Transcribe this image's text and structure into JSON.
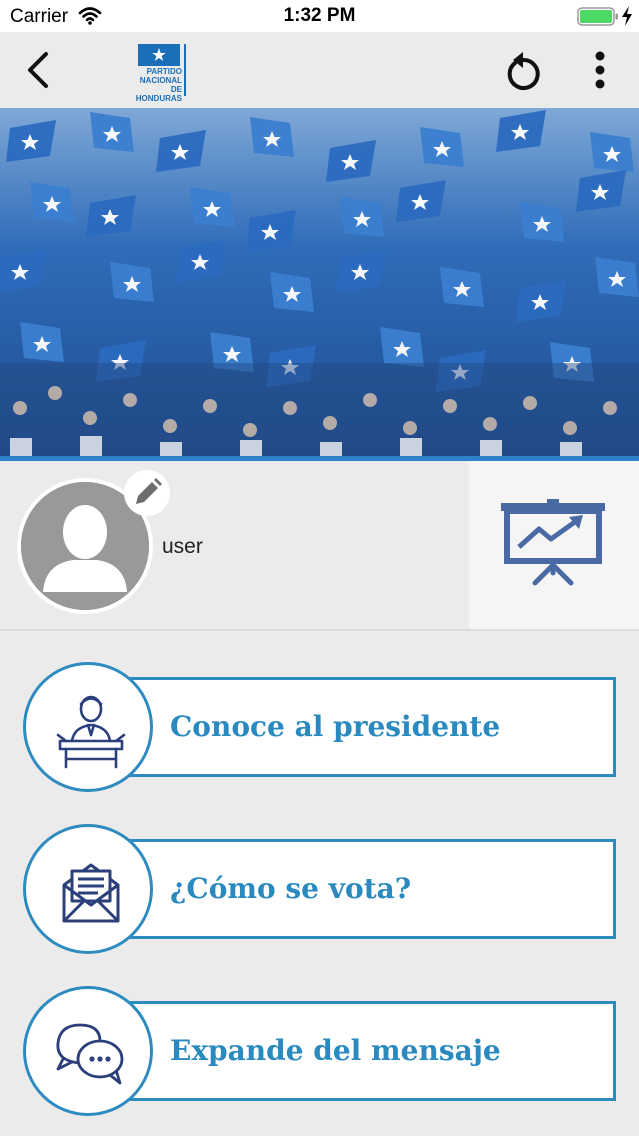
{
  "status_bar": {
    "carrier": "Carrier",
    "time": "1:32 PM",
    "wifi_icon": "wifi-icon",
    "battery_icon": "battery-icon",
    "battery_color": "#4cd964"
  },
  "nav_bar": {
    "back_icon": "chevron-left-icon",
    "logo": {
      "line1": "PARTIDO",
      "line2": "NACIONAL",
      "line3": "DE HONDURAS"
    },
    "refresh_icon": "refresh-icon",
    "more_icon": "more-vertical-icon"
  },
  "profile": {
    "username": "user",
    "avatar_icon": "user-avatar-icon",
    "edit_icon": "pencil-icon",
    "stats_icon": "presentation-chart-icon"
  },
  "menu": {
    "items": [
      {
        "label": "Conoce al presidente",
        "icon": "president-podium-icon"
      },
      {
        "label": "¿Cómo se vota?",
        "icon": "envelope-letter-icon"
      },
      {
        "label": "Expande del mensaje",
        "icon": "chat-bubbles-icon"
      }
    ]
  },
  "colors": {
    "accent": "#2e8bc0",
    "icon_navy": "#2b3f7a",
    "background": "#ebebeb",
    "brand_blue": "#1b6fb8"
  }
}
